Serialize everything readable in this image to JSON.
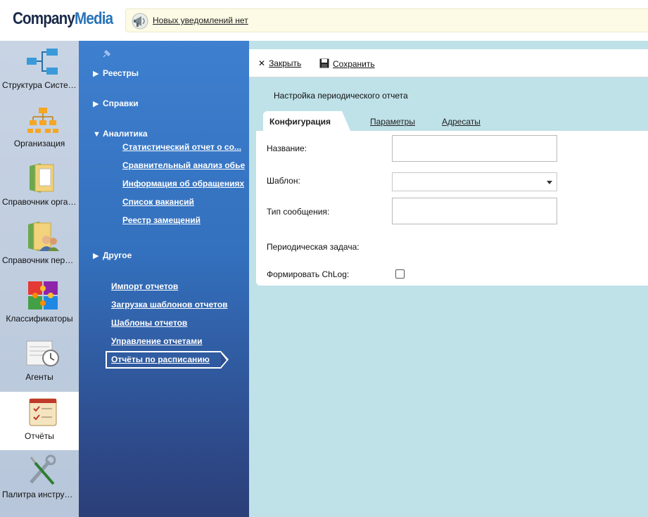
{
  "header": {
    "logo_part1": "Company",
    "logo_part2": "Media",
    "notification_text": "Новых уведомлений нет"
  },
  "nav": {
    "items": [
      {
        "label": "Структура Системы",
        "icon": "structure-icon"
      },
      {
        "label": "Организация",
        "icon": "organization-icon"
      },
      {
        "label": "Справочник организаций",
        "icon": "org-directory-icon"
      },
      {
        "label": "Справочник персонала",
        "icon": "person-directory-icon"
      },
      {
        "label": "Классификаторы",
        "icon": "puzzle-icon"
      },
      {
        "label": "Агенты",
        "icon": "clock-icon"
      },
      {
        "label": "Отчёты",
        "icon": "report-icon"
      },
      {
        "label": "Палитра инструментов",
        "icon": "tools-icon"
      }
    ],
    "active": "Отчёты"
  },
  "sidebar": {
    "sections": {
      "registries": "Реестры",
      "references": "Справки",
      "analytics": "Аналитика",
      "other": "Другое"
    },
    "analytics_items": [
      "Статистический отчет о со...",
      "Сравнительный анализ обье",
      "Информация об обращениях",
      "Список вакансий",
      "Реестр замещений"
    ],
    "links": [
      "Импорт отчетов",
      "Загрузка шаблонов отчетов",
      "Шаблоны отчетов",
      "Управление отчетами"
    ],
    "active_link": "Отчёты по расписанию"
  },
  "toolbar": {
    "close_label": "Закрыть",
    "save_label": "Сохранить"
  },
  "page": {
    "title": "Настройка периодического отчета"
  },
  "tabs": {
    "config": "Конфигурация",
    "params": "Параметры",
    "recipients": "Адресаты"
  },
  "form": {
    "name_label": "Название:",
    "name_value": "",
    "template_label": "Шаблон:",
    "template_value": "",
    "msg_type_label": "Тип сообщения:",
    "msg_type_value": "",
    "periodic_task_label": "Периодическая задача:",
    "chlog_label": "Формировать ChLog:",
    "chlog_checked": false
  }
}
